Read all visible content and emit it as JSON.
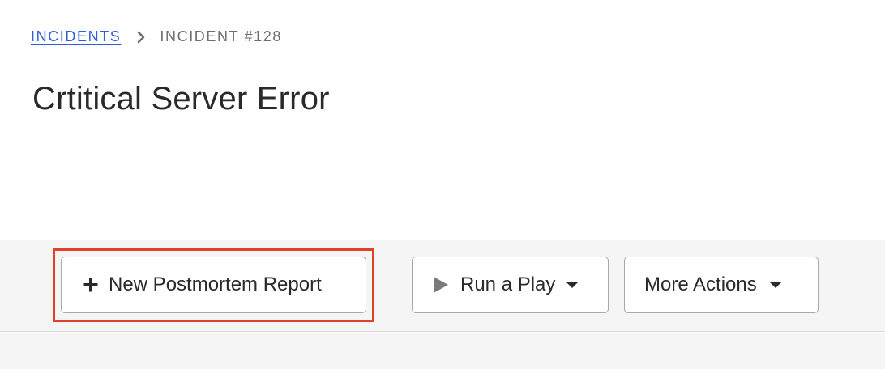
{
  "breadcrumb": {
    "parent_label": "INCIDENTS",
    "current_label": "INCIDENT #128",
    "separator_icon": "chevron-right-icon"
  },
  "page": {
    "title": "Crtitical Server Error"
  },
  "toolbar": {
    "new_postmortem_label": "New Postmortem Report",
    "new_postmortem_icon": "plus-icon",
    "run_play_label": "Run a Play",
    "run_play_icon": "play-icon",
    "more_actions_label": "More Actions",
    "dropdown_icon": "caret-down-icon"
  },
  "colors": {
    "link": "#2f5ed8",
    "highlight": "#e0422c",
    "toolbar_bg": "#f5f5f5",
    "text": "#2a2a2a",
    "muted": "#6e6e6e"
  }
}
